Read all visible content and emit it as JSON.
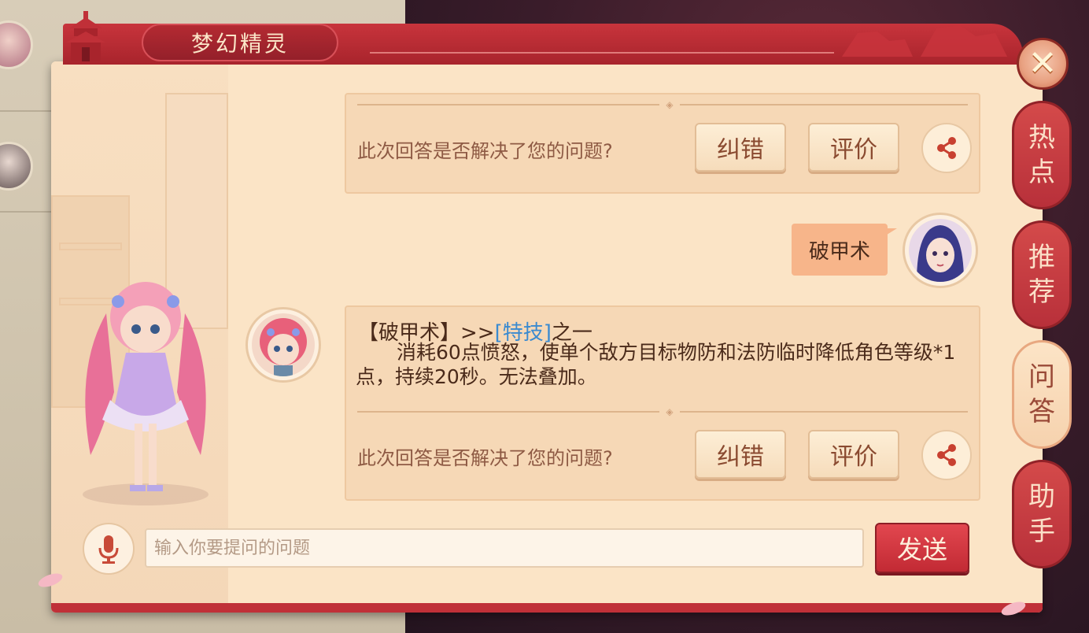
{
  "window": {
    "title": "梦幻精灵",
    "close_icon": "close-icon"
  },
  "side_tabs": [
    {
      "label_1": "热",
      "label_2": "点",
      "active": false
    },
    {
      "label_1": "推",
      "label_2": "荐",
      "active": false
    },
    {
      "label_1": "问",
      "label_2": "答",
      "active": true
    },
    {
      "label_1": "助",
      "label_2": "手",
      "active": false
    }
  ],
  "feedback_card_top": {
    "question": "此次回答是否解决了您的问题?",
    "correct_label": "纠错",
    "rate_label": "评价",
    "share_icon": "share-icon"
  },
  "user_message": {
    "text": "破甲术"
  },
  "answer": {
    "head_prefix": "【破甲术】>>",
    "head_link": "[特技]",
    "head_suffix": "之一",
    "body": "消耗60点愤怒，使单个敌方目标物防和法防临时降低角色等级*1点，持续20秒。无法叠加。"
  },
  "feedback_card_bottom": {
    "question": "此次回答是否解决了您的问题?",
    "correct_label": "纠错",
    "rate_label": "评价",
    "share_icon": "share-icon"
  },
  "input": {
    "placeholder": "输入你要提问的问题",
    "value": "",
    "send_label": "发送",
    "mic_icon": "microphone-icon"
  },
  "colors": {
    "accent_red": "#c22a34",
    "panel_bg": "#fbe4c6",
    "link_blue": "#3a8ad0"
  }
}
